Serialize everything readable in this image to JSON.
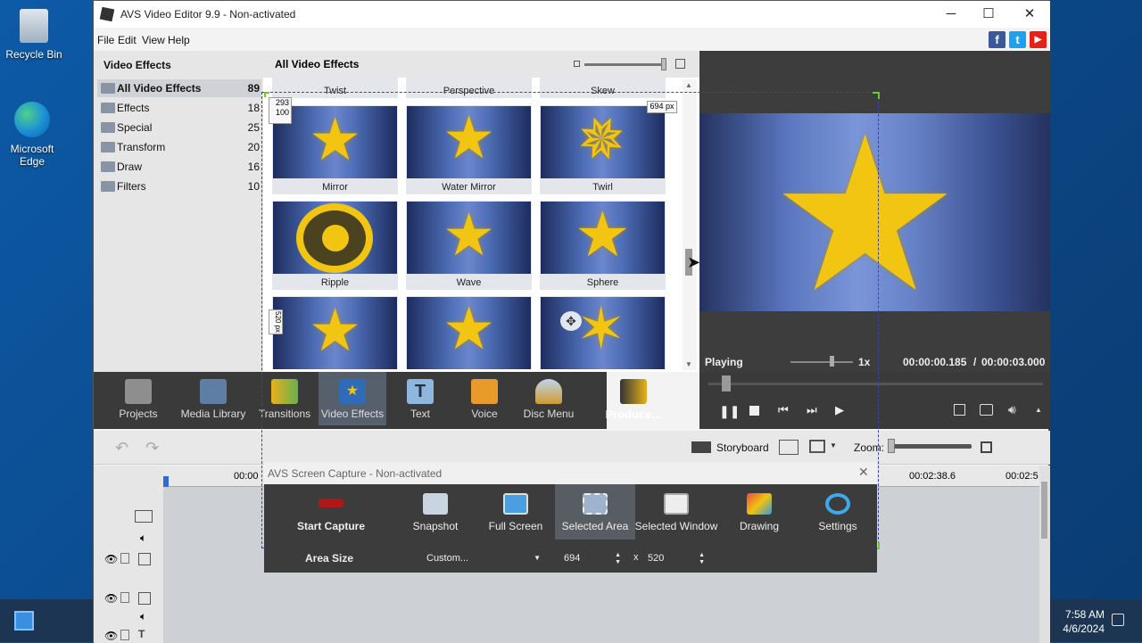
{
  "desktop": {
    "recycle_bin": "Recycle Bin",
    "edge": "Microsoft Edge"
  },
  "taskbar": {
    "time": "7:58 AM",
    "date": "4/6/2024"
  },
  "window": {
    "title": "AVS Video Editor 9.9 - Non-activated",
    "menu": [
      "File",
      "Edit",
      "View",
      "Help"
    ],
    "minimize": "─",
    "maximize": "☐",
    "close": "✕"
  },
  "social": {
    "facebook": "f",
    "twitter": "t",
    "youtube": "▶",
    "facebook_color": "#3b5998",
    "twitter_color": "#1da1f2",
    "youtube_color": "#e62117"
  },
  "left_panel": {
    "title": "Video Effects",
    "categories": [
      {
        "label": "All Video Effects",
        "count": "89"
      },
      {
        "label": "Effects",
        "count": "18"
      },
      {
        "label": "Special",
        "count": "25"
      },
      {
        "label": "Transform",
        "count": "20"
      },
      {
        "label": "Draw",
        "count": "16"
      },
      {
        "label": "Filters",
        "count": "10"
      }
    ]
  },
  "grid": {
    "title": "All Video Effects",
    "top_row": [
      "Twist",
      "Perspective",
      "Skew"
    ],
    "row1": [
      "Mirror",
      "Water Mirror",
      "Twirl"
    ],
    "row2": [
      "Ripple",
      "Wave",
      "Sphere"
    ],
    "markers": {
      "x_offset": "293",
      "y_offset": "100",
      "width": "694 px",
      "height": "520 px"
    }
  },
  "preview": {
    "status": "Playing",
    "speed": "1x",
    "time_current": "00:00:00.185",
    "time_sep": "/",
    "time_total": "00:00:03.000"
  },
  "toolbar": {
    "items": [
      "Projects",
      "Media Library",
      "Transitions",
      "Video Effects",
      "Text",
      "Voice",
      "Disc Menu",
      "Produce..."
    ]
  },
  "timeline": {
    "storyboard": "Storyboard",
    "zoom": "Zoom:",
    "ruler": [
      "00:00",
      "00:02:38.6",
      "00:02:5"
    ]
  },
  "capture": {
    "title": "AVS Screen Capture - Non-activated",
    "buttons": [
      "Start Capture",
      "Snapshot",
      "Full Screen",
      "Selected Area",
      "Selected Window",
      "Drawing",
      "Settings"
    ],
    "area_size_label": "Area Size",
    "area_preset": "Custom...",
    "width": "694",
    "x": "x",
    "height": "520"
  }
}
